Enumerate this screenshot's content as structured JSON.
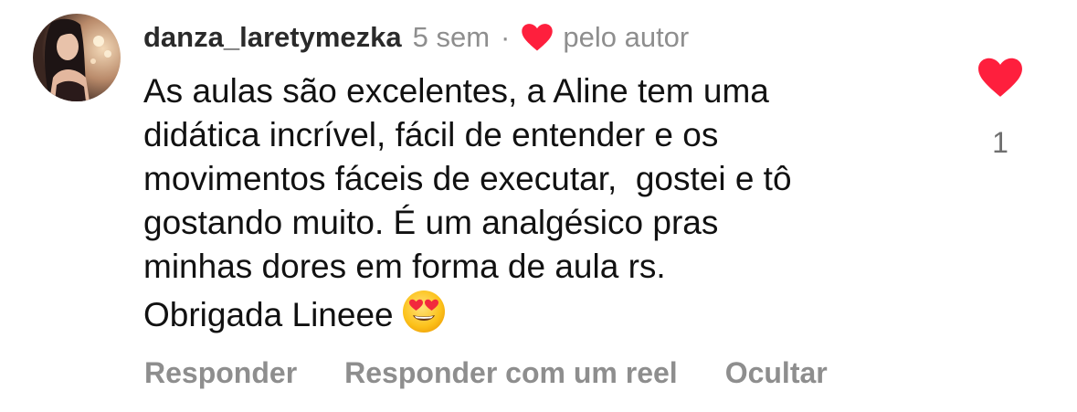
{
  "comment": {
    "username": "danza_laretymezka",
    "time_ago": "5 sem",
    "separator": "·",
    "liked_by_author_label": "pelo autor",
    "text_lines": [
      "As aulas são excelentes, a Aline tem uma",
      "didática incrível, fácil de entender e os",
      "movimentos fáceis de executar,  gostei e tô",
      "gostando muito. É um analgésico pras",
      "minhas dores em forma de aula rs.",
      "Obrigada Lineee"
    ],
    "emoji": "heart-eyes-emoji",
    "like_count": "1",
    "like_state": "liked",
    "icons": {
      "author_heart": "heart-icon",
      "like_button": "heart-filled-icon"
    },
    "colors": {
      "heart": "#fe1f3d",
      "secondary_text": "#8e8e8e",
      "primary_text": "#111111"
    }
  },
  "actions": {
    "reply": "Responder",
    "reply_with_reel": "Responder com um reel",
    "hide": "Ocultar"
  }
}
